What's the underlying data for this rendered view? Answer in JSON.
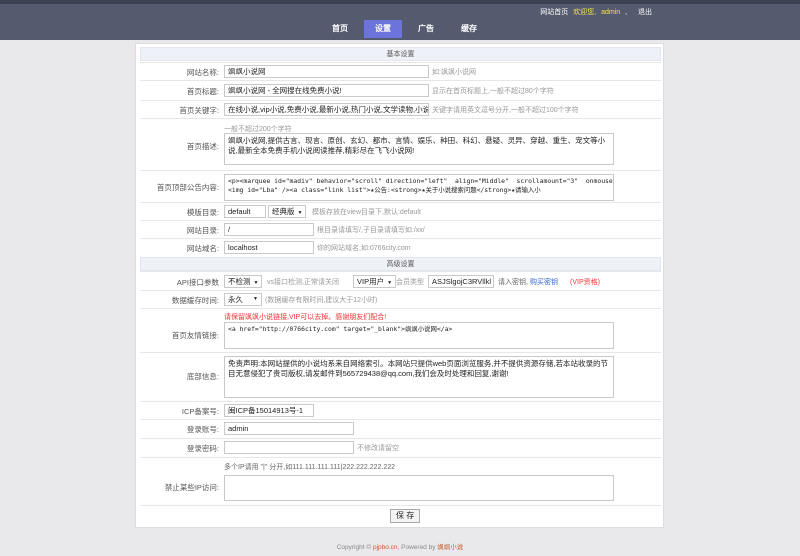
{
  "header": {
    "links": {
      "site_home": "网站首页",
      "welcome": "欢迎您,",
      "user": "admin",
      "sep": ",",
      "logout": "退出"
    },
    "tabs": [
      "首页",
      "设置",
      "广告",
      "缓存"
    ]
  },
  "sections": {
    "basic": "基本设置",
    "advanced": "高级设置"
  },
  "basic": {
    "site_name": {
      "label": "网站名称:",
      "value": "飒飒小说网",
      "hint": "如:飒飒小说网"
    },
    "home_title": {
      "label": "首页标题:",
      "value": "飒飒小说网 - 全网搜在线免费小说!",
      "hint": "显示在首页标题上,一般不超过80个字符"
    },
    "home_keywords": {
      "label": "首页关键字:",
      "value": "在线小说,vip小说,免费小说,最新小说,热门小说,文学读物,小说",
      "hint": "关键字请用英文逗号分开,一般不超过100个字符",
      "hint2": "一般不超过200个字符"
    },
    "home_desc": {
      "label": "首页描述:",
      "value": "飒飒小说网,提供古言、现言、原创、玄幻、都市、言情、娱乐、种田、科幻、悬疑、灵异、穿越、重生、宠文等小说,最新全本免费手机小说阅读推荐,精彩尽在飞飞小说网!"
    },
    "notice": {
      "label": "首页顶部公告内容:",
      "value": "<p><marquee id=\"madiv\" behavior=\"scroll\" direction=\"left\"  align=\"Middle\"  scrollamount=\"3\"  onmouseover=\"this.stop()\" onmouseout=\"this.start();\">\n<img id=\"Lba\" /><a class=\"link list\">★公告:<strong>★关于小说搜索问题</strong>★请输入小"
    },
    "template": {
      "label": "模版目录:",
      "value": "default",
      "select": "经典版",
      "hint": "模板存放在view目录下,默认:default"
    },
    "site_dir": {
      "label": "网站目录:",
      "value": "/",
      "hint": "根目录请填写/,子目录请填写如:/xx/"
    },
    "domain": {
      "label": "网站域名:",
      "value": "localhost",
      "hint": "你的网站域名,如:0766city.com"
    }
  },
  "advanced": {
    "api": {
      "label": "API接口参数",
      "select1": "不检测",
      "hint1": "vs接口检测,正常请关闭",
      "select2": "VIP用户",
      "hint2": "会员类型",
      "key": "ASJSlgojC3RVllkl",
      "hint3": "请入密钥,",
      "buy": "购买密钥",
      "vip": "(VIP资格)"
    },
    "cache_time": {
      "label": "数据缓存时间:",
      "select": "永久",
      "hint": "(数据缓存有限时间,建议大于12小时)"
    },
    "friend_links": {
      "label": "首页友情链接:",
      "note": "请保留飒飒小说链接,VIP可以去掉。感谢朋友们配合!",
      "value": "<a href=\"http://0766city.com\" target=\"_blank\">飒飒小说网</a>"
    },
    "footer_info": {
      "label": "底部信息:",
      "value": "免责声明:本网站提供的小说均系来自网络索引。本网站只提供web页面浏览服务,并不提供资源存储,若本站收录的节目无意侵犯了贵司版权,请发邮件到565729438@qq.com,我们会及时处理和回复,谢谢!"
    },
    "icp": {
      "label": "ICP备案号:",
      "value": "闽ICP备15014913号-1"
    },
    "login_user": {
      "label": "登录账号:",
      "value": "admin"
    },
    "login_pass": {
      "label": "登录密码:",
      "value": "",
      "hint": "不修改请留空"
    },
    "ban_ip": {
      "label": "禁止某些IP访问:",
      "hint": "多个IP请用 \"|\" 分开,如111.111.111.111|222.222.222.222",
      "value": ""
    }
  },
  "save_label": "保 存",
  "footer": {
    "prefix": "Copyright © ",
    "site": "pjpbo.cn",
    "mid": ", Powered by ",
    "brand": "飒飒小说"
  }
}
